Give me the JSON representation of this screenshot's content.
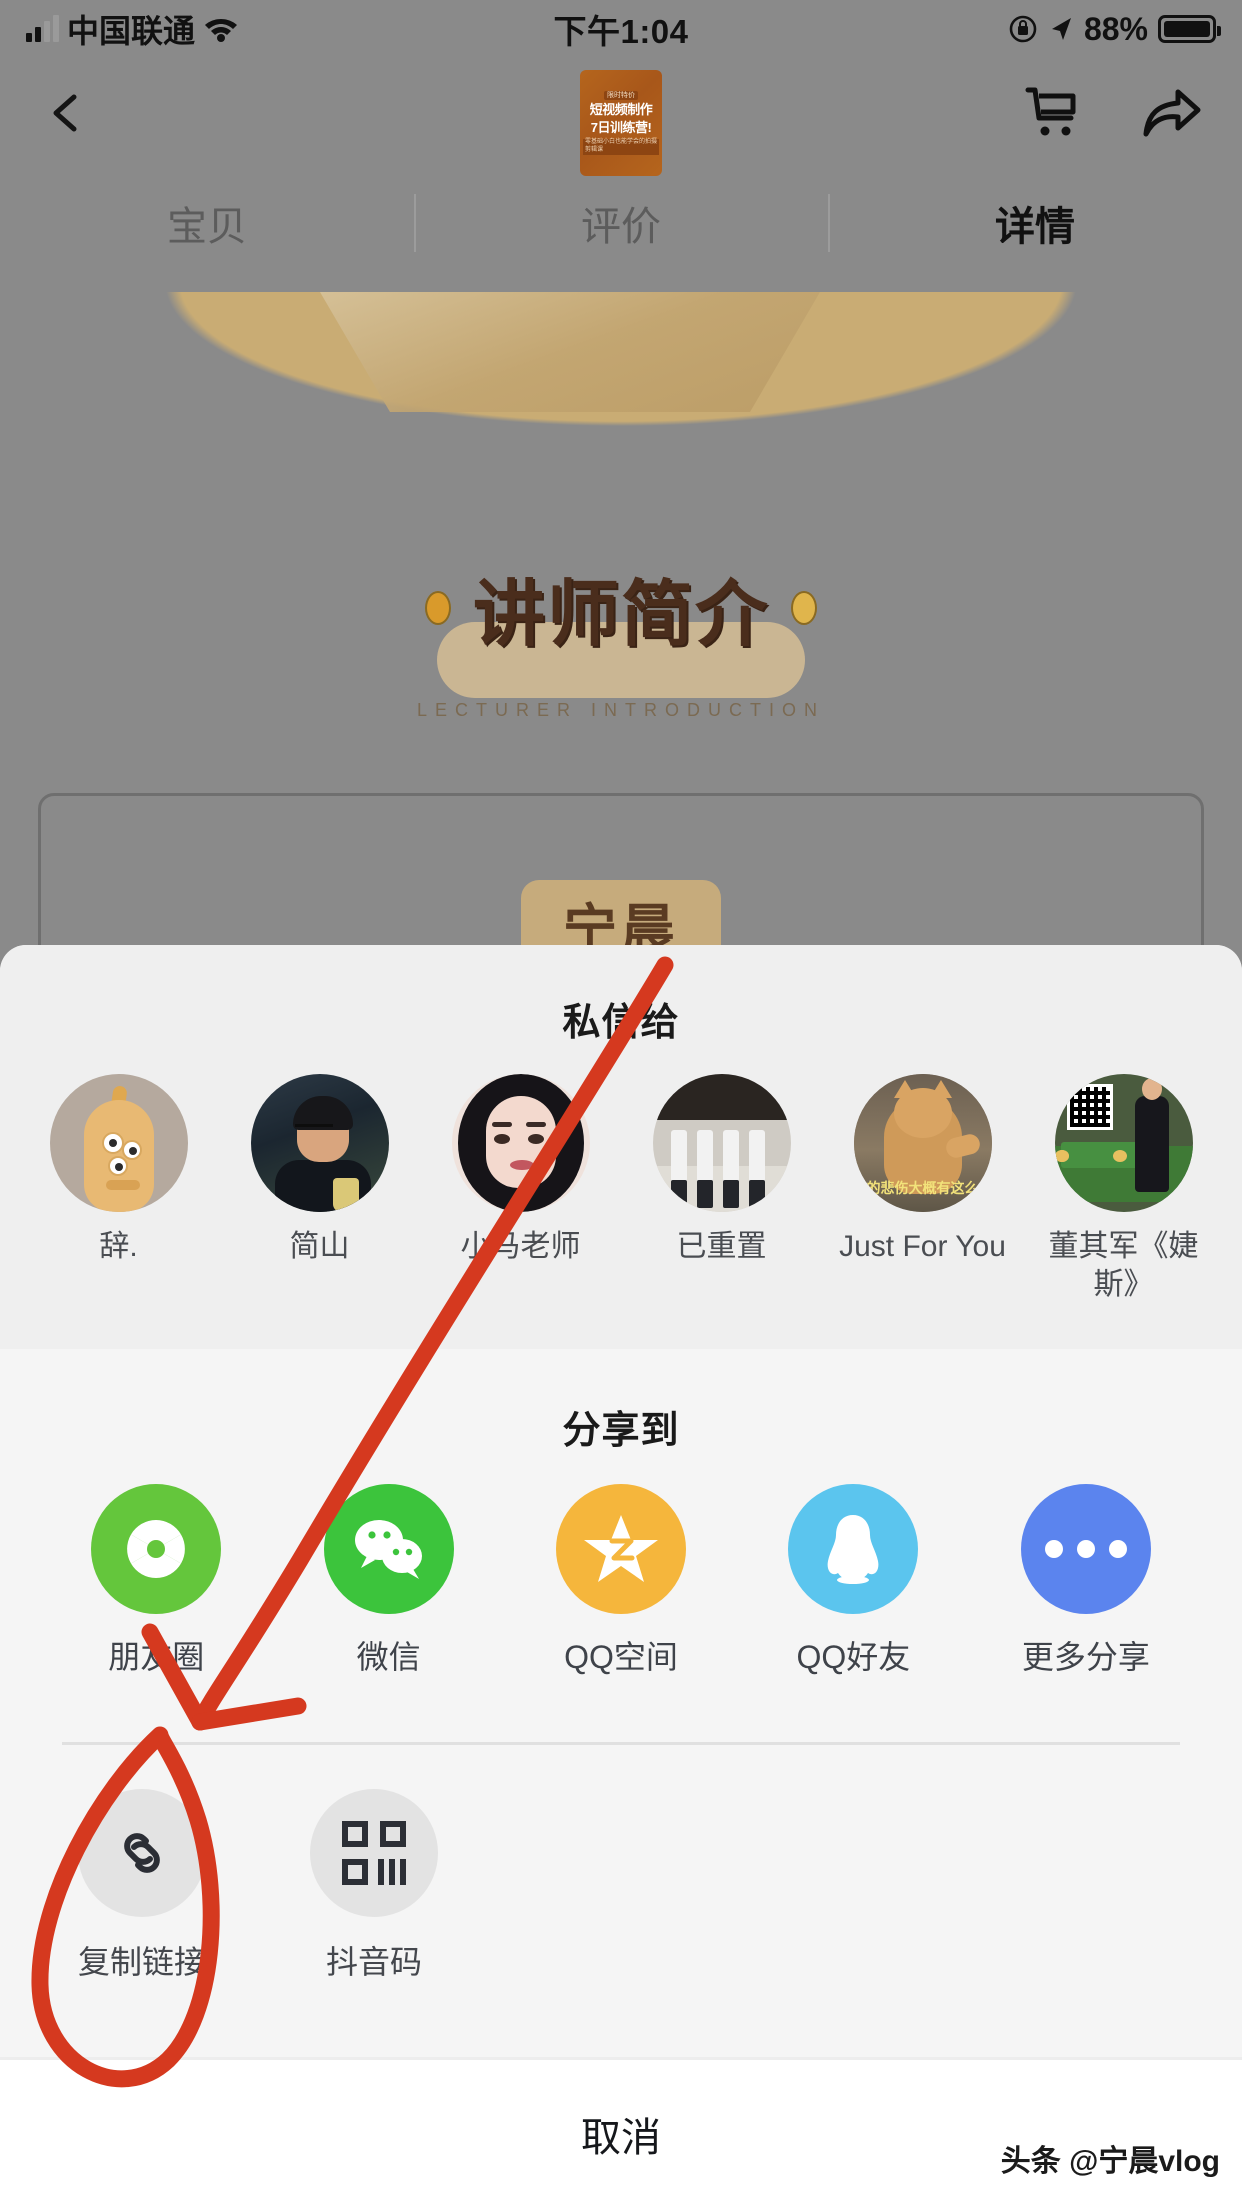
{
  "status_bar": {
    "carrier": "中国联通",
    "time": "下午1:04",
    "battery": "88%",
    "wifi_icon": "wifi-icon",
    "signal_icon": "signal-bars-icon",
    "lock_icon": "rotation-lock-icon",
    "location_icon": "location-arrow-icon"
  },
  "nav": {
    "back_icon": "chevron-left-icon",
    "cart_icon": "shopping-cart-icon",
    "share_icon": "share-arrow-icon",
    "thumb": {
      "badge": "限时特价",
      "line1": "短视频制作",
      "line2": "7日训练营!",
      "line3": "零基础小白也能学会的拍摄剪辑课"
    }
  },
  "tabs": [
    {
      "label": "宝贝",
      "active": false
    },
    {
      "label": "评价",
      "active": false
    },
    {
      "label": "详情",
      "active": true
    }
  ],
  "detail_page": {
    "heading": "讲师简介",
    "subheading": "LECTURER INTRODUCTION",
    "instructor_name": "宁晨"
  },
  "share_sheet": {
    "dm_section": {
      "title": "私信给",
      "contacts": [
        {
          "name": "辞.",
          "avatar": "default-duck-avatar"
        },
        {
          "name": "简山",
          "avatar": "man-photo-avatar"
        },
        {
          "name": "小马老师",
          "avatar": "woman-photo-avatar"
        },
        {
          "name": "已重置",
          "avatar": "group-photo-avatar"
        },
        {
          "name": "Just For You",
          "avatar": "cat-photo-avatar"
        },
        {
          "name": "董其军《婕斯》",
          "avatar": "qr-man-photo-avatar"
        }
      ]
    },
    "share_section": {
      "title": "分享到",
      "platforms": [
        {
          "label": "朋友圈",
          "icon": "moments-icon",
          "color": "#64c63c"
        },
        {
          "label": "微信",
          "icon": "wechat-icon",
          "color": "#3cc43c"
        },
        {
          "label": "QQ空间",
          "icon": "qzone-icon",
          "color": "#f5b63c"
        },
        {
          "label": "QQ好友",
          "icon": "qq-icon",
          "color": "#5bc5ee"
        },
        {
          "label": "更多分享",
          "icon": "more-share-icon",
          "color": "#5b84ee"
        }
      ]
    },
    "actions": [
      {
        "label": "复制链接",
        "icon": "link-chain-icon"
      },
      {
        "label": "抖音码",
        "icon": "douyin-code-icon"
      }
    ],
    "cancel_label": "取消"
  },
  "watermark": "头条 @宁晨vlog",
  "annotation": {
    "color": "#d5391f",
    "shapes": [
      "arrow-pointing-to-copy-link",
      "circle-around-copy-link"
    ]
  }
}
